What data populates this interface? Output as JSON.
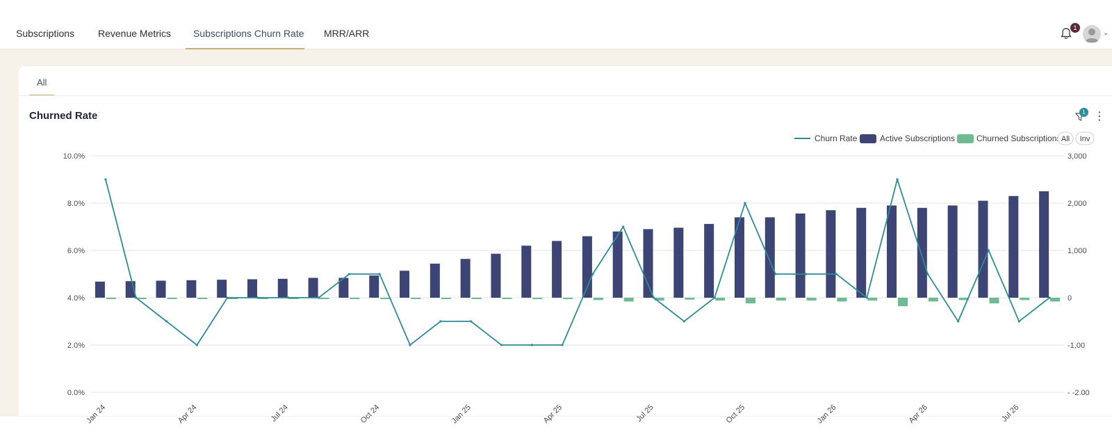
{
  "nav": {
    "tabs": [
      {
        "label": "Subscriptions"
      },
      {
        "label": "Revenue Metrics"
      },
      {
        "label": "Subscriptions Churn Rate"
      },
      {
        "label": "MRR/ARR"
      }
    ],
    "active_tab": 2,
    "notification_count": "1"
  },
  "card": {
    "subtab": "All",
    "filter_count": "1",
    "more_icon": "⋮"
  },
  "legend": {
    "all_label": "All",
    "inv_label": "Inv"
  },
  "icons": [
    "bell-icon",
    "avatar-icon",
    "chevron-down-icon",
    "filter-icon",
    "more-vertical-icon"
  ],
  "colors": {
    "active_bar": "#3c4573",
    "churned_bar": "#6fba93",
    "churn_line": "#2f8a9a",
    "accent": "#c8ad7c"
  },
  "chart_data": {
    "type": "bar",
    "title": "Churned Rate",
    "categories": [
      "Jan 24",
      "Feb 24",
      "Mar 24",
      "Apr 24",
      "May 24",
      "Jun 24",
      "Jul 24",
      "Aug 24",
      "Sep 24",
      "Oct 24",
      "Nov 24",
      "Dec 24",
      "Jan 25",
      "Feb 25",
      "Mar 25",
      "Apr 25",
      "May 25",
      "Jun 25",
      "Jul 25",
      "Aug 25",
      "Sep 25",
      "Oct 25",
      "Nov 25",
      "Dec 25",
      "Jan 26",
      "Feb 26",
      "Mar 26",
      "Apr 26",
      "May 26",
      "Jun 26",
      "Jul 26",
      "Aug 26"
    ],
    "x_tick_labels": [
      "Jan 24",
      "Apr 24",
      "Jul 24",
      "Oct 24",
      "Jan 25",
      "Apr 25",
      "Jul 25",
      "Oct 25",
      "Jan 26",
      "Apr 26",
      "Jul 26"
    ],
    "series": [
      {
        "name": "Churn Rate",
        "kind": "line",
        "axis": "left",
        "values": [
          9.0,
          4.0,
          3.0,
          2.0,
          4.0,
          4.0,
          4.0,
          4.0,
          5.0,
          5.0,
          2.0,
          3.0,
          3.0,
          2.0,
          2.0,
          2.0,
          5.0,
          7.0,
          4.0,
          3.0,
          4.0,
          8.0,
          5.0,
          5.0,
          5.0,
          4.0,
          9.0,
          5.0,
          3.0,
          6.0,
          3.0,
          4.0
        ]
      },
      {
        "name": "Active Subscriptions",
        "kind": "bar",
        "axis": "right",
        "values": [
          340,
          350,
          360,
          370,
          380,
          390,
          400,
          420,
          420,
          470,
          570,
          720,
          820,
          930,
          1100,
          1200,
          1300,
          1400,
          1450,
          1480,
          1560,
          1700,
          1700,
          1780,
          1850,
          1900,
          1950,
          1900,
          1950,
          2050,
          2150,
          2250
        ]
      },
      {
        "name": "Churned Subscriptions",
        "kind": "bar",
        "axis": "right",
        "values": [
          -20,
          -10,
          -10,
          -10,
          -10,
          -10,
          -10,
          -10,
          -10,
          -20,
          -20,
          -20,
          -20,
          -20,
          -30,
          -30,
          -50,
          -80,
          -60,
          -40,
          -60,
          -120,
          -60,
          -60,
          -80,
          -60,
          -180,
          -80,
          -50,
          -120,
          -50,
          -80
        ]
      }
    ],
    "y_left": {
      "ticks": [
        "10.0%",
        "8.0%",
        "6.0%",
        "4.0%",
        "2.0%",
        "0.0%"
      ],
      "min": 0,
      "max": 10,
      "unit": "%"
    },
    "y_right": {
      "ticks": [
        "3,000",
        "2,000",
        "1,000",
        "0",
        "-1,00",
        "- -2.00"
      ],
      "min": -2000,
      "max": 3000
    },
    "grid": true,
    "legend": "top-right"
  }
}
